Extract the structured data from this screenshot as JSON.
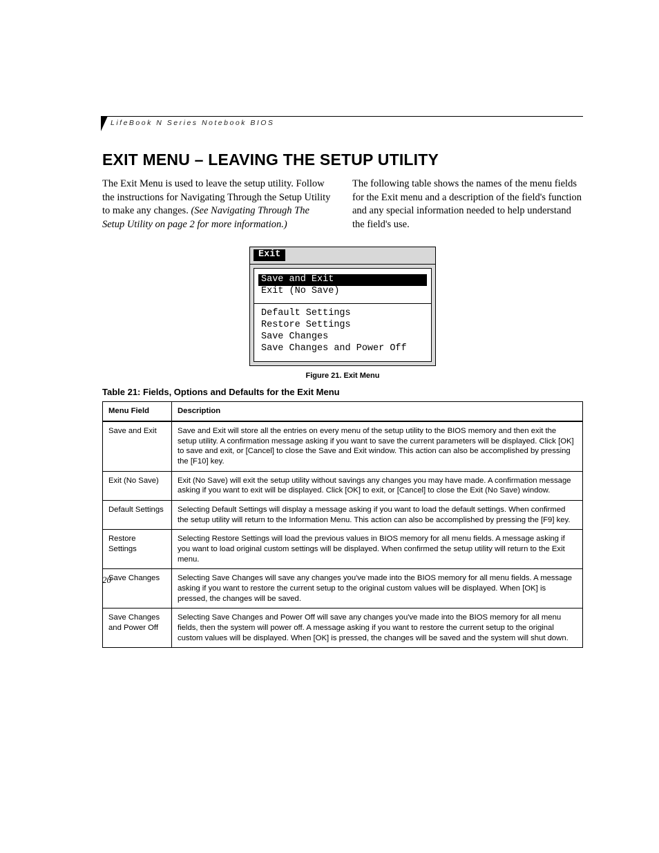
{
  "header": {
    "running": "LifeBook N Series Notebook BIOS"
  },
  "title": "EXIT MENU – LEAVING THE SETUP UTILITY",
  "para_left_plain": "The Exit Menu is used to leave the setup utility. Follow the instructions for Navigating Through the Setup Utility to make any changes. ",
  "para_left_italic": "(See Navigating Through The Setup Utility on page 2 for more information.)",
  "para_right": "The following table shows the names of the menu fields for the Exit menu and a description of the field's function and any special information needed to help understand the field's use.",
  "bios": {
    "tab": "Exit",
    "group1": [
      "Save and Exit",
      "Exit (No Save)"
    ],
    "group2": [
      "Default Settings",
      "Restore Settings",
      "Save Changes",
      "Save Changes and Power Off"
    ],
    "selected_index": 0
  },
  "fig_caption": "Figure 21.  Exit Menu",
  "table_title": "Table 21: Fields, Options and Defaults for the Exit Menu",
  "table": {
    "headers": [
      "Menu Field",
      "Description"
    ],
    "rows": [
      {
        "field": "Save and Exit",
        "desc": "Save and Exit will store all the entries on every menu of the setup utility to the BIOS memory and then exit the setup utility. A confirmation message asking if you want to save the current parameters will be displayed. Click [OK] to save and exit, or [Cancel] to close the Save and Exit window. This action can also be accomplished by pressing the [F10] key."
      },
      {
        "field": "Exit (No Save)",
        "desc": "Exit (No Save) will exit the setup utility without savings any changes you may have made. A confirmation message asking if you want to exit will be displayed. Click [OK] to exit, or [Cancel] to close the Exit (No Save) window."
      },
      {
        "field": "Default Settings",
        "desc": "Selecting Default Settings will display a message asking if you want to load the default settings. When confirmed the setup utility will return to the Information Menu. This action can also be accomplished by pressing the [F9] key."
      },
      {
        "field": "Restore Settings",
        "desc": "Selecting Restore Settings will load the previous values in BIOS memory for all menu fields. A message asking if you want to load original custom settings will be displayed. When confirmed the setup utility will return to the Exit menu."
      },
      {
        "field": "Save Changes",
        "desc": "Selecting Save Changes will save any changes you've made into the BIOS memory for all menu fields. A message asking if you want to restore the current setup to the original custom values will be displayed. When [OK] is pressed, the changes will be saved."
      },
      {
        "field": "Save Changes and Power Off",
        "desc": "Selecting Save Changes and Power Off will save any changes you've made into the BIOS memory for all menu fields, then the system will power off. A message asking if you want to restore the current setup to the original custom values will be displayed. When [OK] is pressed, the changes will be saved and the system will shut down."
      }
    ]
  },
  "page_number": "20"
}
